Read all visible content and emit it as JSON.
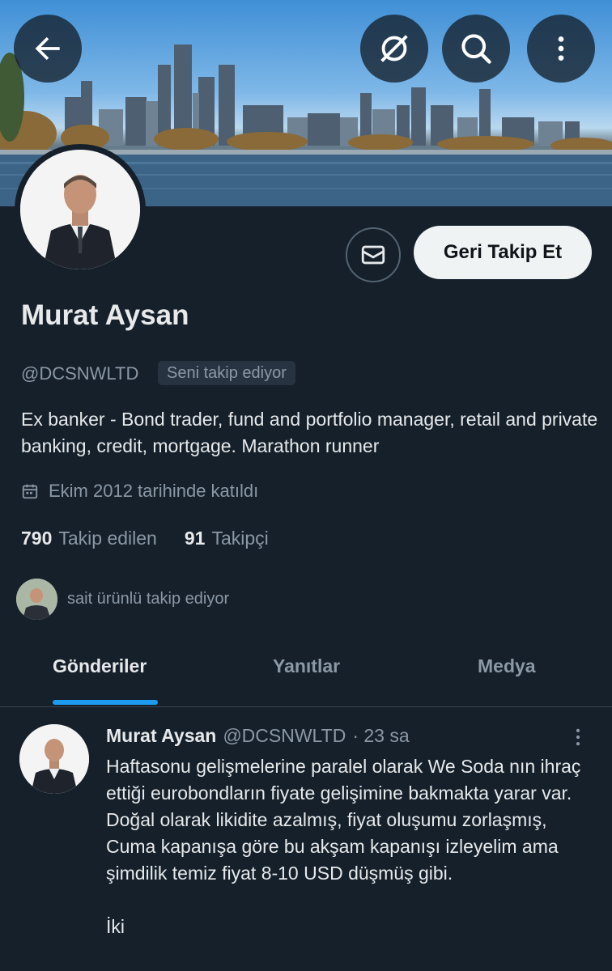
{
  "header": {
    "back_icon": "arrow-left-icon",
    "translate_icon": "translate-icon",
    "search_icon": "search-icon",
    "more_icon": "more-vertical-icon"
  },
  "profile": {
    "name": "Murat Aysan",
    "handle": "@DCSNWLTD",
    "follows_you": "Seni takip ediyor",
    "bio": "Ex banker - Bond trader, fund and portfolio manager, retail and private banking, credit, mortgage. Marathon runner",
    "joined": "Ekim 2012 tarihinde katıldı",
    "following_count": "790",
    "following_label": "Takip edilen",
    "followers_count": "91",
    "followers_label": "Takipçi",
    "followed_by": "sait ürünlü takip ediyor"
  },
  "actions": {
    "follow_back": "Geri Takip Et",
    "message_icon": "mail-icon"
  },
  "tabs": [
    {
      "label": "Gönderiler",
      "active": true
    },
    {
      "label": "Yanıtlar",
      "active": false
    },
    {
      "label": "Medya",
      "active": false
    }
  ],
  "tweet": {
    "name": "Murat Aysan",
    "handle": "@DCSNWLTD",
    "time": "· 23 sa",
    "text": "Haftasonu gelişmelerine paralel olarak We Soda nın ihraç ettiği eurobondların fiyate gelişimine bakmakta yarar var. Doğal olarak likidite azalmış, fiyat oluşumu zorlaşmış, Cuma kapanışa göre bu akşam kapanışı izleyelim ama şimdilik temiz fiyat 8-10 USD düşmüş gibi.\n\nİki"
  },
  "colors": {
    "background": "#15202b",
    "accent": "#1d9bf0",
    "text": "#e7e9ea",
    "secondary": "#8b98a5"
  }
}
